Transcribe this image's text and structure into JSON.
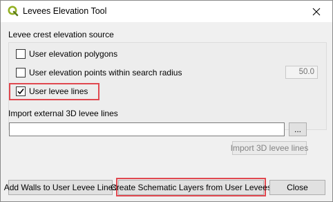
{
  "window": {
    "title": "Levees Elevation Tool"
  },
  "icons": {
    "app": "qgis-logo-icon",
    "close": "close-icon",
    "check": "check-icon"
  },
  "colors": {
    "highlight": "#e0484f",
    "qgis_green": "#93b023"
  },
  "crest": {
    "label": "Levee crest elevation source",
    "options": [
      {
        "label": "User elevation polygons",
        "checked": false
      },
      {
        "label": "User elevation points within search radius",
        "checked": false
      },
      {
        "label": "User levee lines",
        "checked": true
      }
    ],
    "radius_value": "50.0"
  },
  "import": {
    "label": "Import external 3D levee lines",
    "path_value": "",
    "browse_label": "...",
    "import_button": "Import 3D levee lines"
  },
  "footer": {
    "add_walls": "Add Walls to User Levee Lines",
    "create_schematic": "Create Schematic Layers from User Levees",
    "close": "Close"
  }
}
